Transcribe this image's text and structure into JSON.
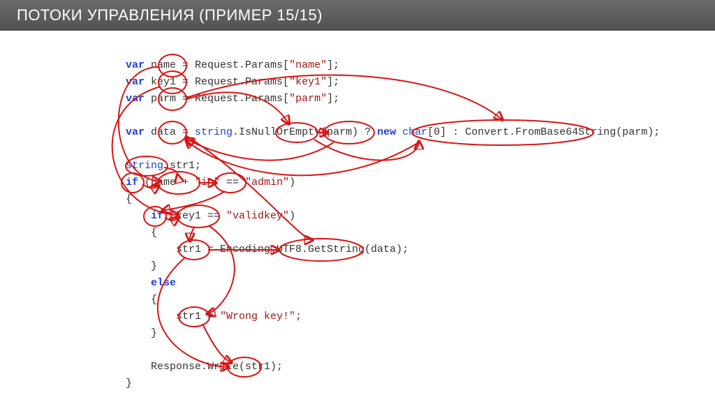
{
  "slide": {
    "title": "ПОТОКИ УПРАВЛЕНИЯ (ПРИМЕР 15/15)"
  },
  "code": {
    "kw_var": "var",
    "kw_string_t": "string",
    "kw_string": "string",
    "kw_if": "if",
    "kw_else": "else",
    "kw_new": "new",
    "kw_char": "char",
    "l1_a": " name = Request.Params[",
    "l1_s": "\"name\"",
    "l1_b": "];",
    "l2_a": " key1 = Request.Params[",
    "l2_s": "\"key1\"",
    "l2_b": "];",
    "l3_a": " parm = Request.Params[",
    "l3_s": "\"parm\"",
    "l3_b": "];",
    "l5_a": " data = ",
    "l5_b": ".IsNullOrEmpty(parm) ? ",
    "l5_c": "[0] : Convert.FromBase64String(parm);",
    "l7_a": " str1;",
    "l8_a": " (name + ",
    "l8_s1": "\"in\"",
    "l8_b": " == ",
    "l8_s2": "\"admin\"",
    "l8_c": ")",
    "l9": "{",
    "l10_a": "    ",
    "l10_b": " (key1 == ",
    "l10_s": "\"validkey\"",
    "l10_c": ")",
    "l11": "    {",
    "l12": "        str1 = Encoding.UTF8.GetString(data);",
    "l13": "    }",
    "l14": "    ",
    "l15": "    {",
    "l16_a": "        str1 = ",
    "l16_s": "\"Wrong key!\"",
    "l16_b": ";",
    "l17": "    }",
    "l19": "    Response.Write(str1);",
    "l20": "}"
  }
}
